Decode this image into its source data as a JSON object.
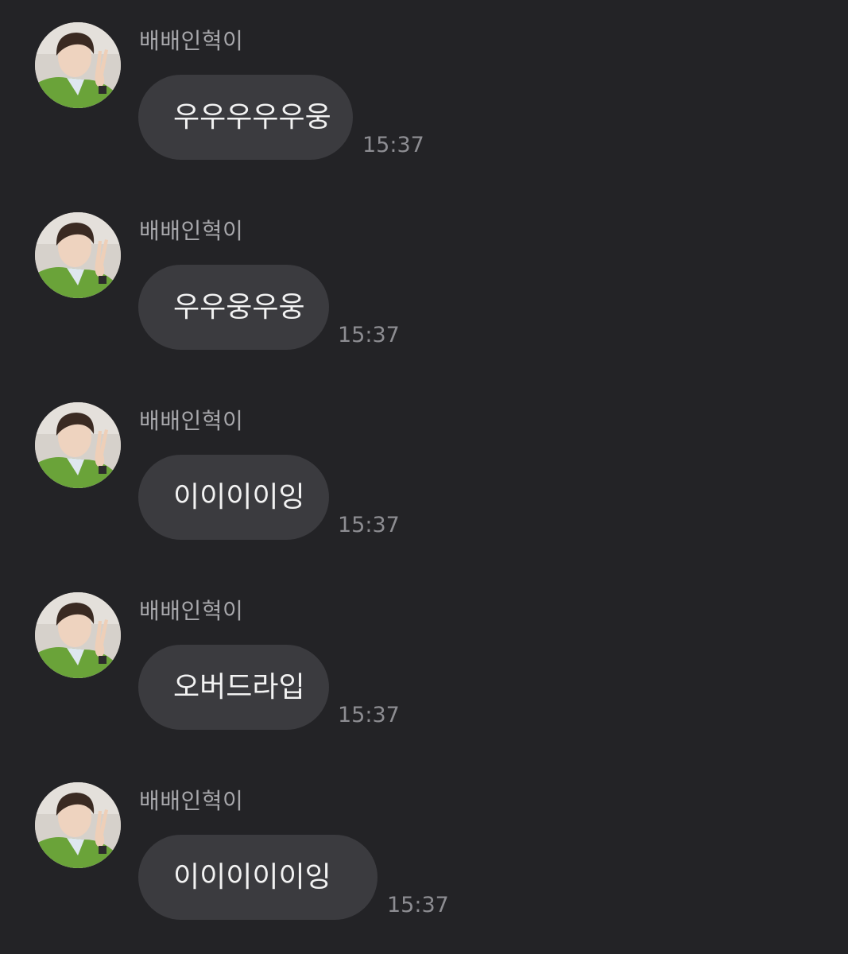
{
  "chat": {
    "messages": [
      {
        "sender": "배배인혁이",
        "text": "우우우우우웅",
        "time": "15:37"
      },
      {
        "sender": "배배인혁이",
        "text": "우우웅우웅",
        "time": "15:37"
      },
      {
        "sender": "배배인혁이",
        "text": "이이이이잉",
        "time": "15:37"
      },
      {
        "sender": "배배인혁이",
        "text": "오버드라입",
        "time": "15:37"
      },
      {
        "sender": "배배인혁이",
        "text": "이이이이이잉",
        "time": "15:37"
      }
    ]
  },
  "colors": {
    "background": "#232326",
    "bubble": "#3b3b3f",
    "sender_text": "#a7a7ab",
    "time_text": "#8d8d92",
    "message_text": "#f2f2f2"
  },
  "icons": {
    "avatar": "profile-photo"
  }
}
